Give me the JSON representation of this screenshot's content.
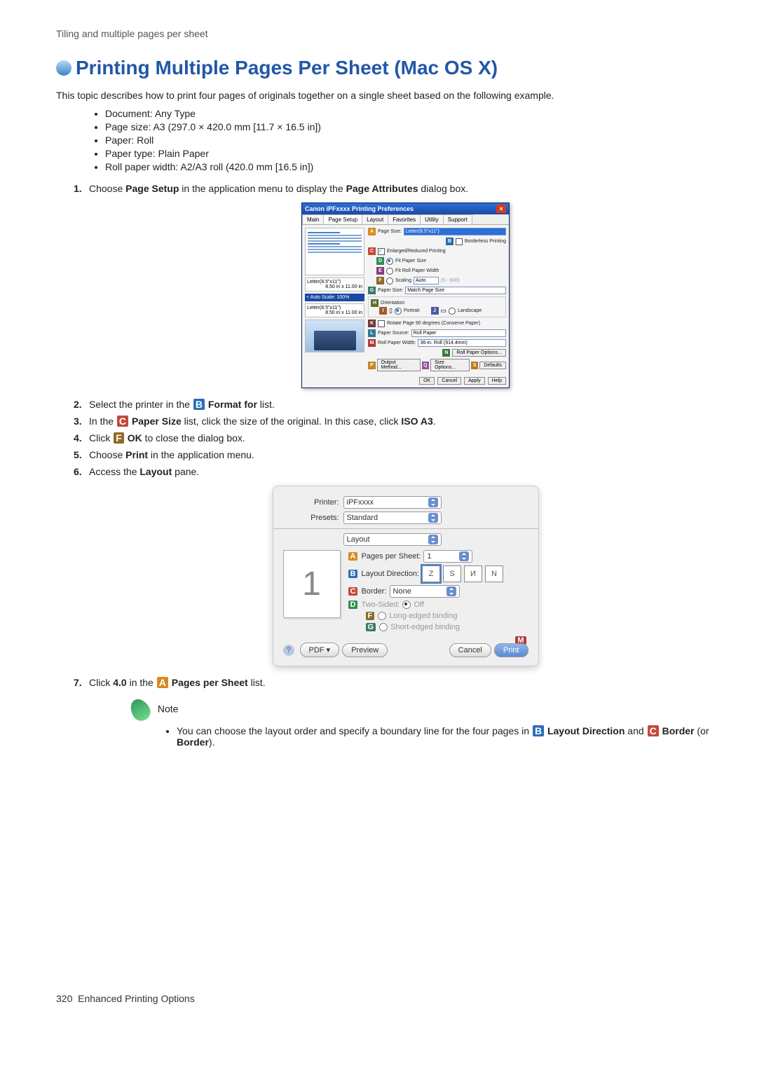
{
  "breadcrumb": "Tiling and multiple pages per sheet",
  "title": "Printing Multiple Pages Per Sheet (Mac OS X)",
  "intro": "This topic describes how to print four pages of originals together on a single sheet based on the following example.",
  "specs": {
    "document": "Document:  Any Type",
    "page_size": "Page size:  A3 (297.0 × 420.0 mm [11.7 × 16.5 in])",
    "paper": "Paper:  Roll",
    "paper_type": "Paper type:  Plain Paper",
    "roll_width": "Roll paper width:  A2/A3 roll (420.0 mm [16.5 in])"
  },
  "steps": {
    "s1_a": "Choose ",
    "s1_b": "Page Setup",
    "s1_c": " in the application menu to display the ",
    "s1_d": "Page Attributes",
    "s1_e": " dialog box.",
    "s2_a": "Select the printer in the ",
    "s2_l": "B",
    "s2_b": "Format for",
    "s2_c": " list.",
    "s3_a": "In the ",
    "s3_l": "C",
    "s3_b": "Paper Size",
    "s3_c": " list, click the size of the original.  In this case, click ",
    "s3_d": "ISO A3",
    "s3_e": ".",
    "s4_a": "Click ",
    "s4_l": "F",
    "s4_b": "OK",
    "s4_c": " to close the dialog box.",
    "s5_a": "Choose ",
    "s5_b": "Print",
    "s5_c": " in the application menu.",
    "s6_a": "Access the ",
    "s6_b": "Layout",
    "s6_c": " pane.",
    "s7_a": "Click ",
    "s7_b": "4.0",
    "s7_c": " in the ",
    "s7_l": "A",
    "s7_d": "Pages per Sheet",
    "s7_e": " list."
  },
  "win_dialog": {
    "title": "Canon iPFxxxx Printing Preferences",
    "tabs": [
      "Main",
      "Page Setup",
      "Layout",
      "Favorites",
      "Utility",
      "Support"
    ],
    "size1_line1": "Letter(8.5\"x11\")",
    "size1_line2": "8.50 in x 11.00 in",
    "blue_band": "+ Auto Scale: 100%",
    "size2_line1": "Letter(8.5\"x11\")",
    "size2_line2": "8.50 in x 11.00 in",
    "page_size_label": "Page Size:",
    "page_size_value": "Letter(8.5\"x11\")",
    "borderless_label": "Borderless Printing",
    "enlarge_label": "Enlarged/Reduced Printing",
    "fit_paper": "Fit Paper Size",
    "fit_roll": "Fit Roll Paper Width",
    "scaling": "Scaling",
    "scaling_value": "Auto",
    "scaling_range": "(5 - 600)",
    "paper_size_label": "Paper Size:",
    "paper_size_value": "Match Page Size",
    "orientation_label": "Orientation",
    "portrait": "Portrait",
    "landscape": "Landscape",
    "rotate_label": "Rotate Page 90 degrees (Conserve Paper)",
    "paper_source_label": "Paper Source:",
    "paper_source_value": "Roll Paper",
    "roll_width_label": "Roll Paper Width:",
    "roll_width_value": "36-in. Roll (914.4mm)",
    "roll_options_btn": "Roll Paper Options...",
    "output_btn": "Output Method...",
    "size_options_btn": "Size Options...",
    "defaults_btn": "Defaults",
    "ok_btn": "OK",
    "cancel_btn": "Cancel",
    "apply_btn": "Apply",
    "help_btn": "Help"
  },
  "mac_dialog": {
    "printer_label": "Printer:",
    "printer_value": "iPFxxxx",
    "presets_label": "Presets:",
    "presets_value": "Standard",
    "pane_value": "Layout",
    "pages_label": "Pages per Sheet:",
    "pages_value": "1",
    "layout_dir_label": "Layout Direction:",
    "border_label": "Border:",
    "border_value": "None",
    "twosided_label": "Two-Sided:",
    "off_label": "Off",
    "long_bind": "Long-edged binding",
    "short_bind": "Short-edged binding",
    "preview_digit": "1",
    "pdf_btn": "PDF ▾",
    "preview_btn": "Preview",
    "cancel_btn": "Cancel",
    "print_btn": "Print"
  },
  "note": {
    "title": "Note",
    "body_a": "You can choose the layout order and specify a boundary line for the four pages in ",
    "l1": "B",
    "body_b": "Layout Direction",
    "body_c": " and ",
    "l2": "C",
    "body_d": "Border",
    "body_e": " (or ",
    "body_f": "Border",
    "body_g": ")."
  },
  "footer": {
    "page_num": "320",
    "section": "Enhanced Printing Options"
  }
}
